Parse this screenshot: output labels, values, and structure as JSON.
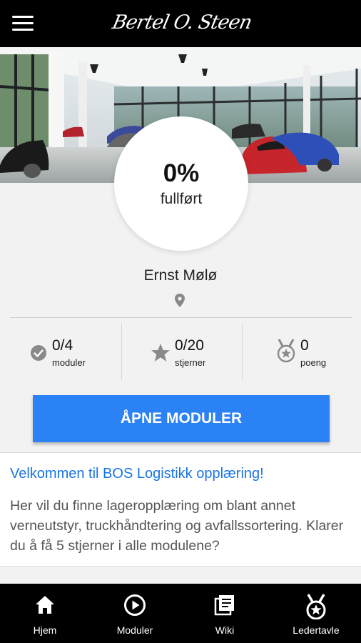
{
  "header": {
    "menu_icon": "hamburger-menu-icon",
    "logo_text": "Bertel O. Steen"
  },
  "hero": {
    "image": "car-showroom-photo"
  },
  "progress": {
    "percent_text": "0%",
    "label": "fullført",
    "fraction": 0
  },
  "user": {
    "name": "Ernst Mølø",
    "location_icon": "location-pin-icon"
  },
  "stats": [
    {
      "icon": "check-circle-icon",
      "value": "0/4",
      "label": "moduler"
    },
    {
      "icon": "star-icon",
      "value": "0/20",
      "label": "stjerner"
    },
    {
      "icon": "medal-icon",
      "value": "0",
      "label": "poeng"
    }
  ],
  "actions": {
    "open_modules_label": "ÅPNE MODULER"
  },
  "welcome": {
    "title": "Velkommen til BOS Logistikk opplæring!",
    "text": "Her vil du finne lageropplæring om blant annet verneutstyr, truckhåndtering og avfallssortering. Klarer du å få 5 stjerner i alle modulene?"
  },
  "nav": [
    {
      "icon": "home-icon",
      "label": "Hjem"
    },
    {
      "icon": "play-circle-icon",
      "label": "Moduler"
    },
    {
      "icon": "book-icon",
      "label": "Wiki"
    },
    {
      "icon": "medal-icon",
      "label": "Ledertavle"
    }
  ],
  "colors": {
    "accent": "#2b82f5",
    "link": "#1a73e8",
    "bar": "#000000"
  }
}
